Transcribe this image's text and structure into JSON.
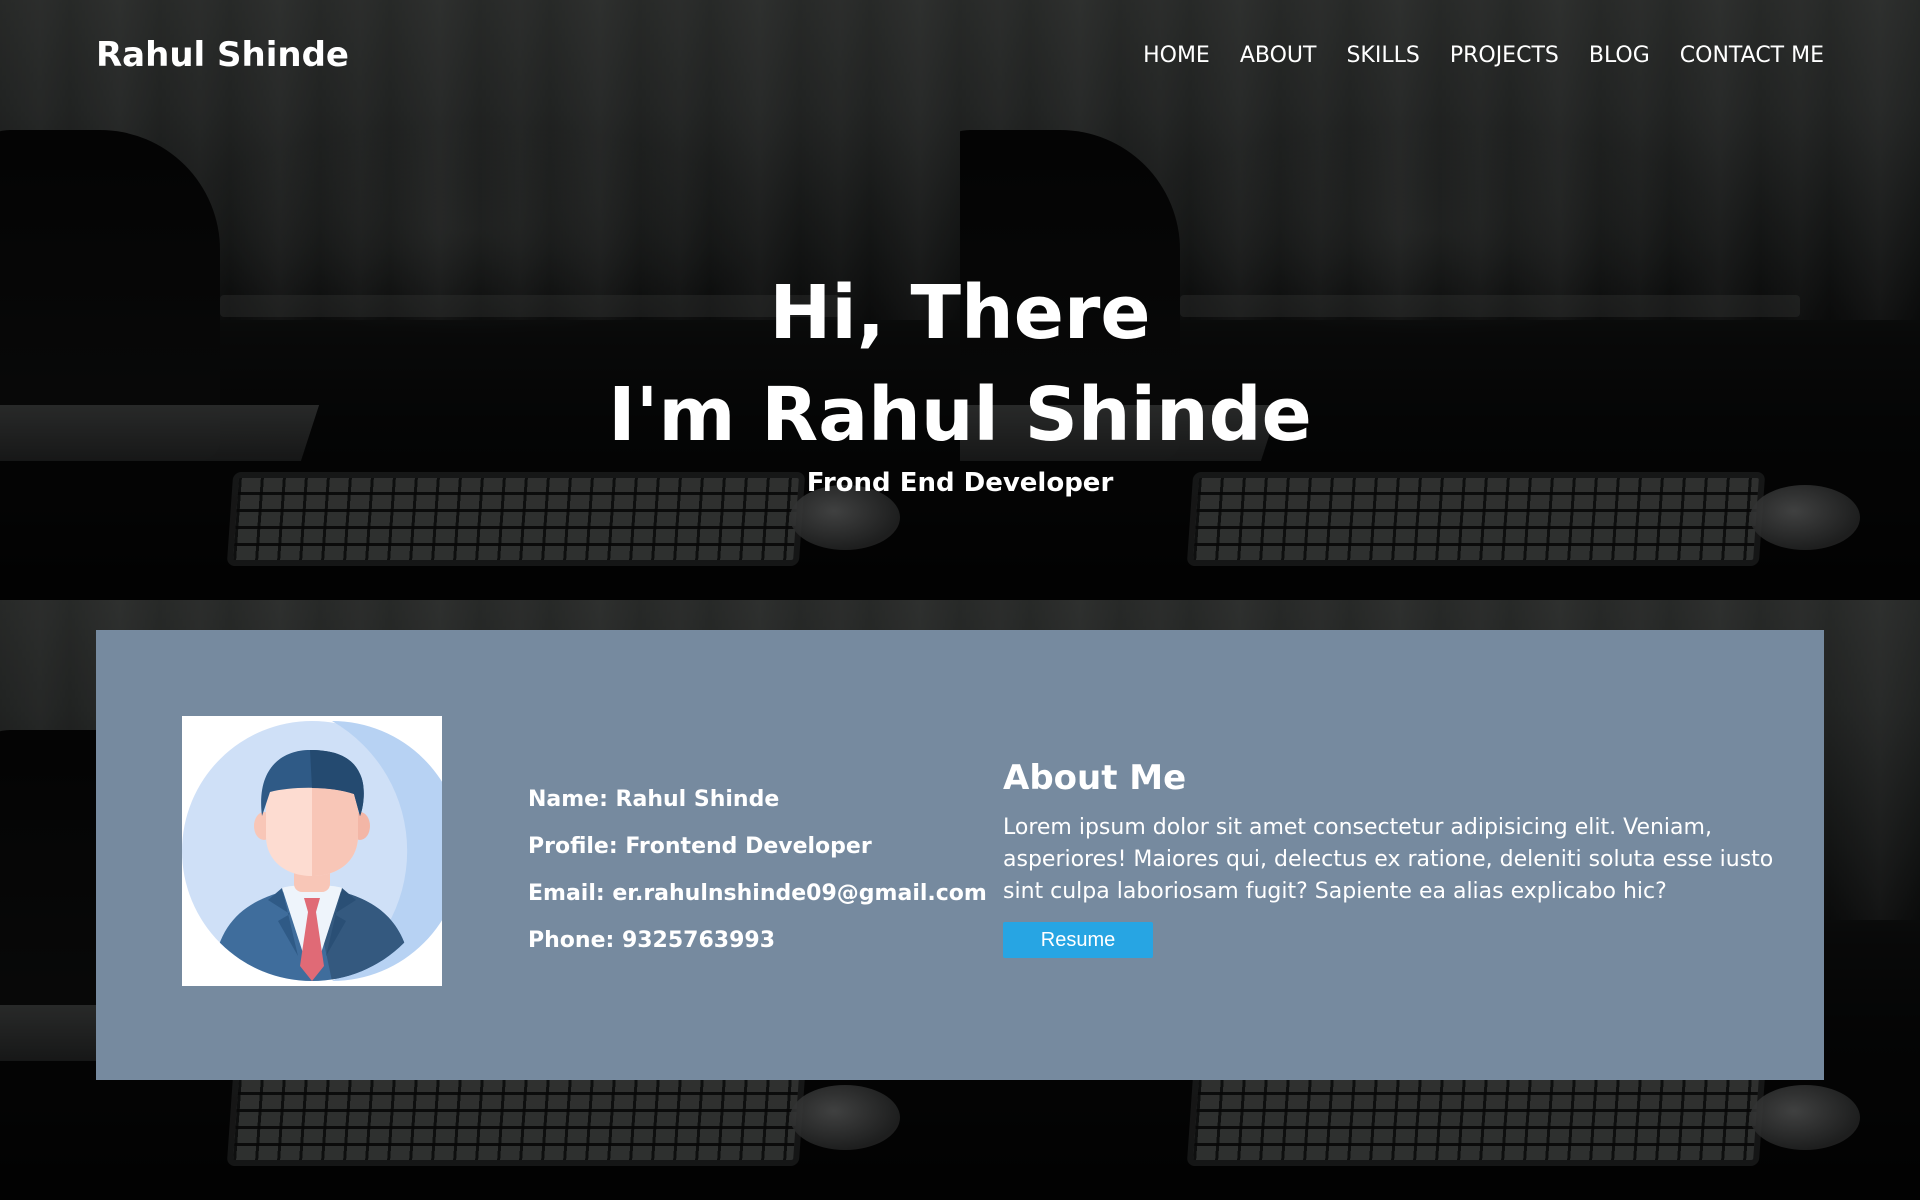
{
  "navbar": {
    "brand": "Rahul Shinde",
    "links": [
      {
        "label": "HOME"
      },
      {
        "label": "ABOUT"
      },
      {
        "label": "SKILLS"
      },
      {
        "label": "PROJECTS"
      },
      {
        "label": "BLOG"
      },
      {
        "label": "CONTACT ME"
      }
    ]
  },
  "hero": {
    "greeting": "Hi, There",
    "intro": "I'm Rahul Shinde",
    "role": "Frond End Developer"
  },
  "about": {
    "avatar_icon": "businessman-avatar-icon",
    "info": {
      "name": "Name: Rahul Shinde",
      "profile": "Profile: Frontend Developer",
      "email": "Email: er.rahulnshinde09@gmail.com",
      "phone": "Phone: 9325763993"
    },
    "title": "About Me",
    "paragraph": "Lorem ipsum dolor sit amet consectetur adipisicing elit. Veniam, asperiores! Maiores qui, delectus ex ratione, deleniti soluta esse iusto sint culpa laboriosam fugit? Sapiente ea alias explicabo hic?",
    "resume_label": "Resume"
  },
  "colors": {
    "card_background": "#768a9f",
    "button_accent": "#27a5e3",
    "text": "#ffffff"
  }
}
